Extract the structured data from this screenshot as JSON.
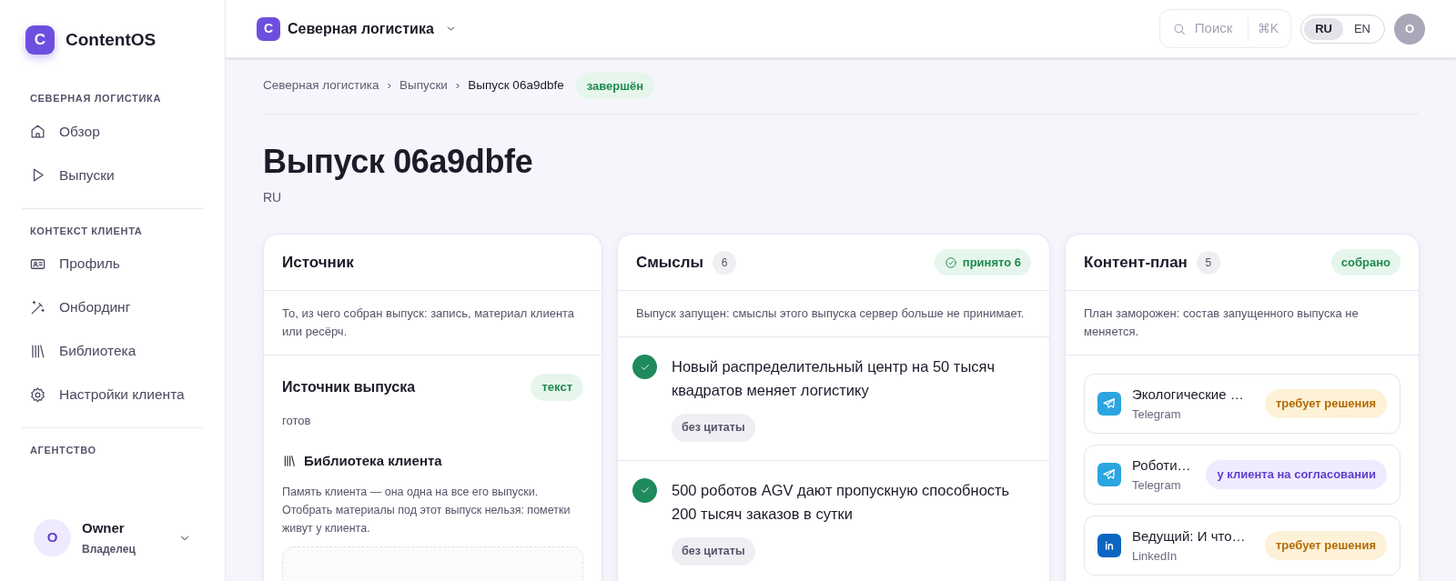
{
  "app": {
    "logo_letter": "C",
    "name": "ContentOS"
  },
  "sidebar": {
    "sections": [
      {
        "title": "СЕВЕРНАЯ ЛОГИСТИКА",
        "items": [
          {
            "label": "Обзор"
          },
          {
            "label": "Выпуски"
          }
        ]
      },
      {
        "title": "КОНТЕКСТ КЛИЕНТА",
        "items": [
          {
            "label": "Профиль"
          },
          {
            "label": "Онбординг"
          },
          {
            "label": "Библиотека"
          },
          {
            "label": "Настройки клиента"
          }
        ]
      },
      {
        "title": "АГЕНТСТВО"
      }
    ],
    "user": {
      "initial": "O",
      "name": "Owner",
      "role": "Владелец"
    }
  },
  "header": {
    "workspace_letter": "С",
    "workspace": "Северная логистика",
    "search_placeholder": "Поиск",
    "shortcut": "⌘K",
    "languages": [
      {
        "label": "RU",
        "selected": true
      },
      {
        "label": "EN",
        "selected": false
      }
    ],
    "avatar": "O"
  },
  "breadcrumbs": [
    {
      "label": "Северная логистика"
    },
    {
      "separator": "›",
      "label": "Выпуски"
    },
    {
      "separator": "›",
      "label": "Выпуск 06a9dbfe"
    }
  ],
  "status": "завершён",
  "title": "Выпуск 06a9dbfe",
  "language": "RU",
  "source_card": {
    "title": "Источник",
    "description": "То, из чего собран выпуск: запись, материал клиента или ресёрч.",
    "source": {
      "title": "Источник выпуска",
      "badge": "текст",
      "state": "готов"
    },
    "library": {
      "title": "Библиотека клиента",
      "text": "Память клиента — она одна на все его выпуски. Отобрать материалы под этот выпуск нельзя: пометки живут у клиента."
    }
  },
  "meanings_card": {
    "title": "Смыслы",
    "count": "6",
    "badge": "принято 6",
    "description": "Выпуск запущен: смыслы этого выпуска сервер больше не принимает.",
    "items": [
      {
        "text": "Новый распределительный центр на 50 тысяч квадратов меняет логистику",
        "accepted": true,
        "tag": "без цитаты"
      },
      {
        "text": "500 роботов AGV дают пропускную способность 200 тысяч заказов в сутки",
        "accepted": true,
        "tag": "без цитаты"
      }
    ]
  },
  "plan_card": {
    "title": "Контент-план",
    "count": "5",
    "badge": "собрано",
    "description": "План заморожен: состав запущенного выпуска не меняется.",
    "items": [
      {
        "title": "Экологические …",
        "channel": "Telegram",
        "kind": "telegram",
        "status": {
          "label": "требует решения",
          "kind": "decision"
        }
      },
      {
        "title": "Роботи…",
        "channel": "Telegram",
        "kind": "telegram",
        "status": {
          "label": "у клиента на согласовании",
          "kind": "client"
        }
      },
      {
        "title": "Ведущий: И что…",
        "channel": "LinkedIn",
        "kind": "linkedin",
        "status": {
          "label": "требует решения",
          "kind": "decision"
        }
      }
    ]
  }
}
